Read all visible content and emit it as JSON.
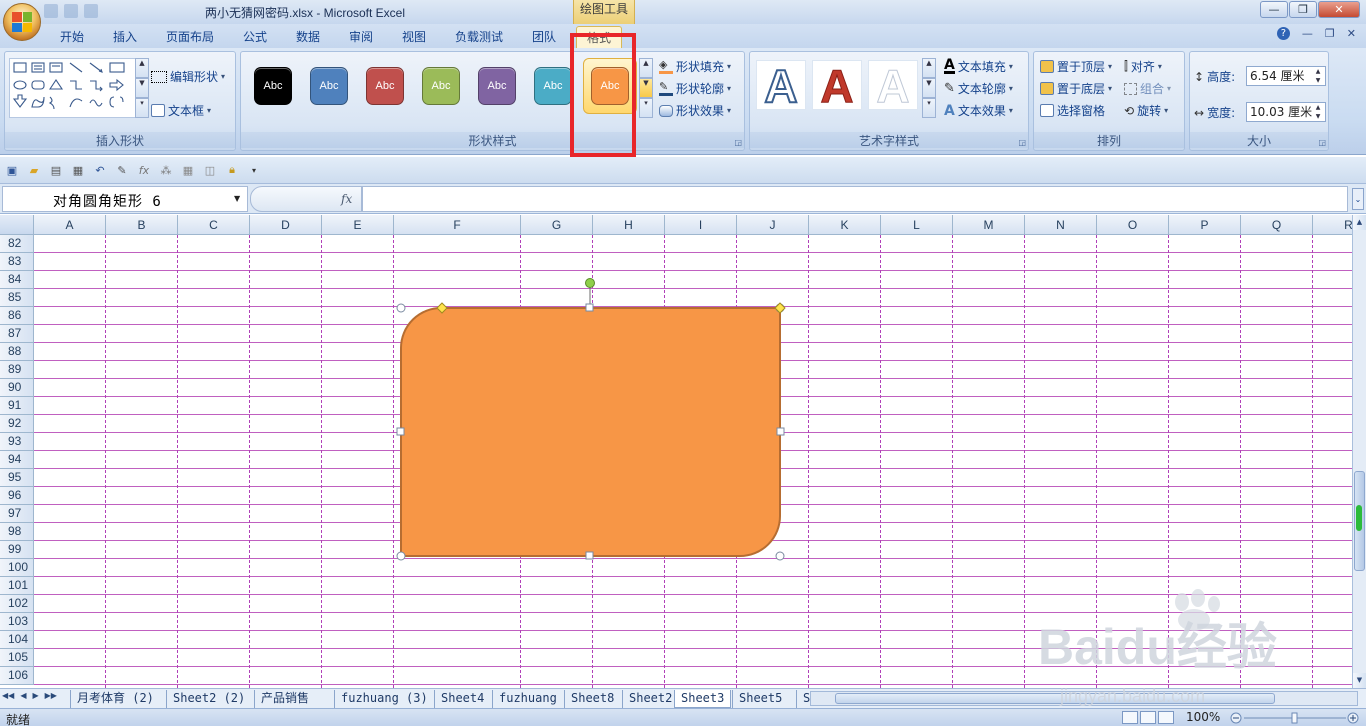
{
  "window": {
    "title": "两小无猜网密码.xlsx - Microsoft Excel",
    "context_tab_group": "绘图工具",
    "minimize": "—",
    "restore": "❐",
    "close": "✕"
  },
  "tabs": [
    "开始",
    "插入",
    "页面布局",
    "公式",
    "数据",
    "审阅",
    "视图",
    "负载测试",
    "团队",
    "格式"
  ],
  "active_tab": "格式",
  "help_icons": [
    "?",
    "—",
    "❐",
    "✕"
  ],
  "ribbon": {
    "insert_shapes": {
      "label": "插入形状",
      "edit_shape": "编辑形状",
      "text_box": "文本框"
    },
    "shape_styles": {
      "label": "形状样式",
      "swatches": [
        {
          "text": "Abc",
          "color": "#000000"
        },
        {
          "text": "Abc",
          "color": "#4f81bd"
        },
        {
          "text": "Abc",
          "color": "#c0504d"
        },
        {
          "text": "Abc",
          "color": "#9bbb59"
        },
        {
          "text": "Abc",
          "color": "#8064a2"
        },
        {
          "text": "Abc",
          "color": "#4bacc6"
        },
        {
          "text": "Abc",
          "color": "#f79646"
        }
      ],
      "fill": "形状填充",
      "outline": "形状轮廓",
      "effects": "形状效果"
    },
    "wordart_styles": {
      "label": "艺术字样式",
      "letter": "A",
      "text_fill": "文本填充",
      "text_outline": "文本轮廓",
      "text_effects": "文本效果"
    },
    "arrange": {
      "label": "排列",
      "bring_front": "置于顶层",
      "send_back": "置于底层",
      "selection_pane": "选择窗格",
      "align": "对齐",
      "group": "组合",
      "rotate": "旋转"
    },
    "size": {
      "label": "大小",
      "height_label": "高度:",
      "height_value": "6.54 厘米",
      "width_label": "宽度:",
      "width_value": "10.03 厘米"
    }
  },
  "formula_bar": {
    "name_box": "对角圆角矩形 6",
    "fx": "fx",
    "formula": ""
  },
  "columns": [
    "A",
    "B",
    "C",
    "D",
    "E",
    "F",
    "G",
    "H",
    "I",
    "J",
    "K",
    "L",
    "M",
    "N",
    "O",
    "P",
    "Q",
    "R"
  ],
  "rows": [
    "82",
    "83",
    "84",
    "85",
    "86",
    "87",
    "88",
    "89",
    "90",
    "91",
    "92",
    "93",
    "94",
    "95",
    "96",
    "97",
    "98",
    "99",
    "100",
    "101",
    "102",
    "103",
    "104",
    "105",
    "106"
  ],
  "shape": {
    "fill": "#f79646",
    "stroke": "#b66d31"
  },
  "sheet_tabs": [
    "月考体育 (2)",
    "Sheet2 (2)",
    "产品销售",
    "fuzhuang (3)",
    "Sheet4",
    "fuzhuang",
    "Sheet8",
    "Sheet2",
    "Sheet3",
    "Sheet5",
    "S"
  ],
  "active_sheet": "Sheet3",
  "status": {
    "ready": "就绪",
    "zoom": "100%"
  },
  "watermark": {
    "brand": "Baidu经验",
    "url": "jingyan.baidu.com"
  }
}
